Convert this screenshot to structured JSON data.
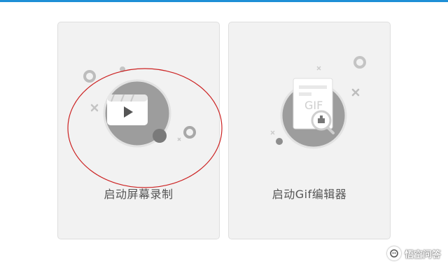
{
  "cards": [
    {
      "label": "启动屏幕录制",
      "icon": "video-play-icon",
      "highlighted": true
    },
    {
      "label": "启动Gif编辑器",
      "icon": "gif-editor-icon",
      "highlighted": false
    }
  ],
  "annotation": {
    "shape": "ellipse",
    "color": "#cc2222"
  },
  "watermark": {
    "text": "悟空问答"
  },
  "colors": {
    "accent_bar": "#1e8fd6",
    "card_bg": "#f2f2f2",
    "icon_circle": "#9d9d9d",
    "label_text": "#555555"
  }
}
